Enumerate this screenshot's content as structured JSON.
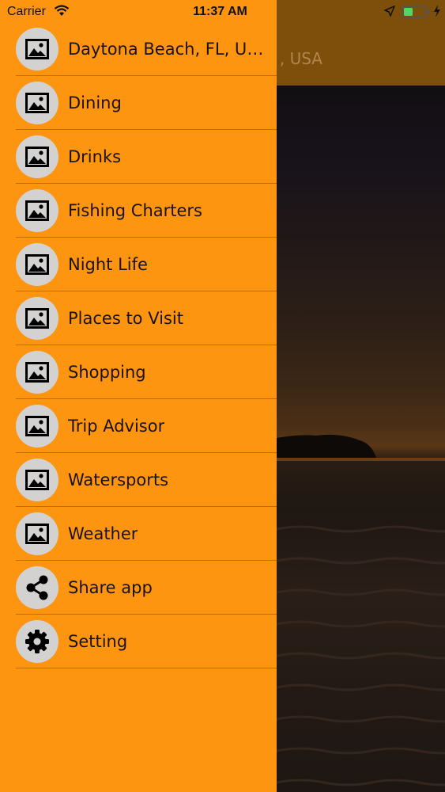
{
  "status_bar": {
    "carrier": "Carrier",
    "time": "11:37 AM"
  },
  "background_screen": {
    "title_fragment": ", USA"
  },
  "menu": {
    "items": [
      {
        "label": "Daytona Beach, FL, US...",
        "icon": "image-icon"
      },
      {
        "label": "Dining",
        "icon": "image-icon"
      },
      {
        "label": "Drinks",
        "icon": "image-icon"
      },
      {
        "label": "Fishing Charters",
        "icon": "image-icon"
      },
      {
        "label": "Night Life",
        "icon": "image-icon"
      },
      {
        "label": "Places to Visit",
        "icon": "image-icon"
      },
      {
        "label": "Shopping",
        "icon": "image-icon"
      },
      {
        "label": "Trip Advisor",
        "icon": "image-icon"
      },
      {
        "label": "Watersports",
        "icon": "image-icon"
      },
      {
        "label": "Weather",
        "icon": "image-icon"
      },
      {
        "label": "Share app",
        "icon": "share-icon"
      },
      {
        "label": "Setting",
        "icon": "gear-icon"
      }
    ]
  },
  "colors": {
    "drawer_background": "#fd9510",
    "icon_circle": "#d4d2d0",
    "header_background": "#7d4f0a"
  }
}
